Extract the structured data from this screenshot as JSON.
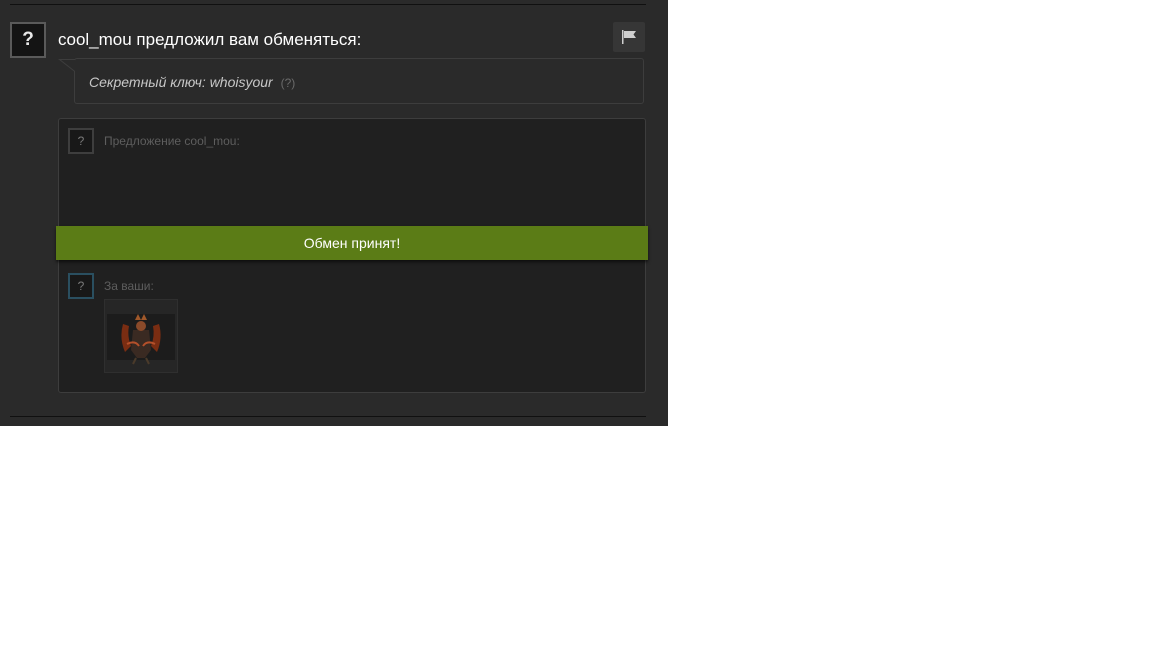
{
  "offer": {
    "avatar_glyph": "?",
    "headline": "cool_mou предложил вам обменяться:",
    "flag_icon": "flag-icon",
    "secret_label": "Секретный ключ: whoisyour",
    "secret_help": "(?)"
  },
  "trade": {
    "their_avatar_glyph": "?",
    "their_label": "Предложение cool_mou:",
    "status": "Обмен принят!",
    "your_avatar_glyph": "?",
    "your_label": "За ваши:",
    "items": [
      "dota-hero-item"
    ]
  },
  "colors": {
    "background": "#2a2a2a",
    "trade_box": "#202020",
    "accepted": "#5b7c16"
  }
}
